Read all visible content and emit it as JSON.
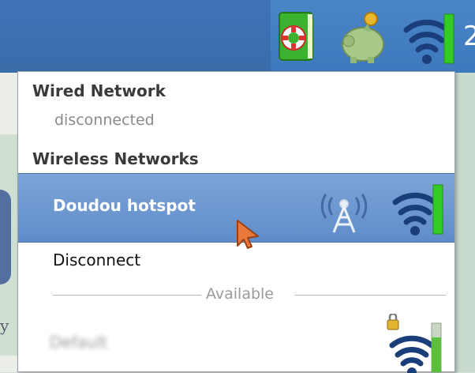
{
  "panel": {
    "clock_partial": "2",
    "tray_icons": [
      "help-book-icon",
      "piggy-bank-icon",
      "wifi-signal-icon"
    ]
  },
  "menu": {
    "wired_header": "Wired Network",
    "wired_status": "disconnected",
    "wireless_header": "Wireless Networks",
    "connected_network": {
      "label": "Doudou hotspot",
      "signal_strength": 1.0,
      "icons": [
        "access-point-icon",
        "wifi-signal-icon"
      ]
    },
    "disconnect_label": "Disconnect",
    "available_separator": "Available",
    "available_networks": [
      {
        "label": "Default",
        "locked": true,
        "signal_strength": 0.6
      }
    ]
  },
  "colors": {
    "panel": "#3a6fb0",
    "selection": "#6e98d0",
    "signal_green": "#33cc22",
    "signal_dark": "#1a3e7a"
  }
}
